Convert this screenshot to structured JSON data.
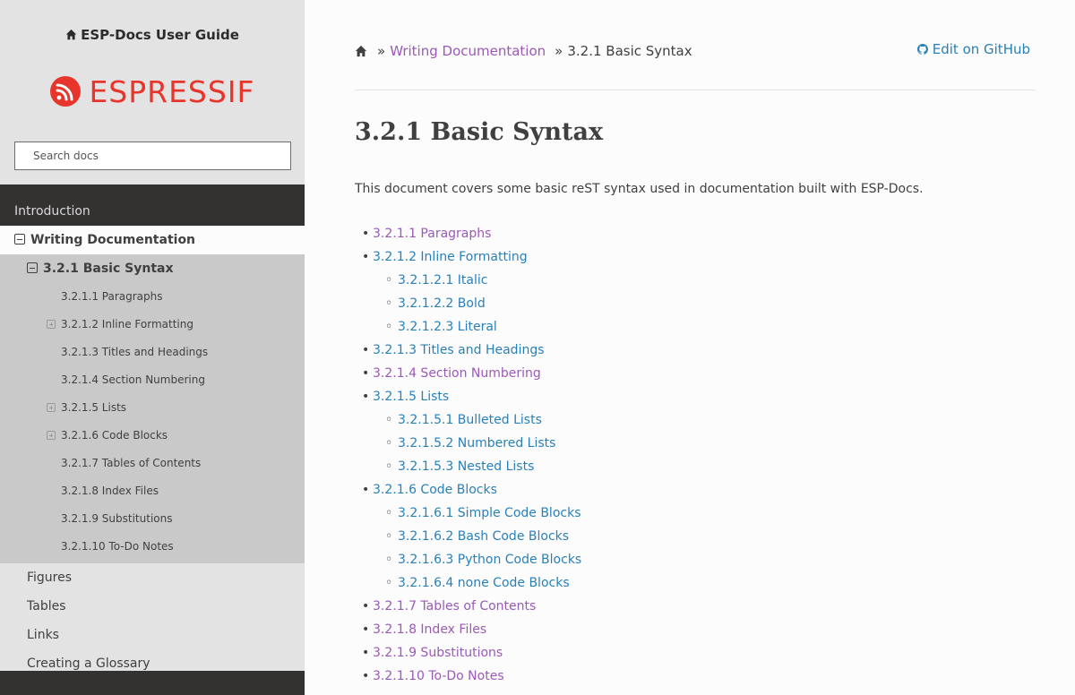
{
  "sidebar": {
    "project_title": "ESP-Docs User Guide",
    "logo_text": "ESPRESSIF",
    "search_placeholder": "Search docs",
    "intro": "Introduction",
    "writing_docs": "Writing Documentation",
    "basic_syntax": "3.2.1 Basic Syntax",
    "sub_items": [
      {
        "label": "3.2.1.1 Paragraphs",
        "expandable": false
      },
      {
        "label": "3.2.1.2 Inline Formatting",
        "expandable": true
      },
      {
        "label": "3.2.1.3 Titles and Headings",
        "expandable": false
      },
      {
        "label": "3.2.1.4 Section Numbering",
        "expandable": false
      },
      {
        "label": "3.2.1.5 Lists",
        "expandable": true
      },
      {
        "label": "3.2.1.6 Code Blocks",
        "expandable": true
      },
      {
        "label": "3.2.1.7 Tables of Contents",
        "expandable": false
      },
      {
        "label": "3.2.1.8 Index Files",
        "expandable": false
      },
      {
        "label": "3.2.1.9 Substitutions",
        "expandable": false
      },
      {
        "label": "3.2.1.10 To-Do Notes",
        "expandable": false
      }
    ],
    "other_items": [
      "Figures",
      "Tables",
      "Links",
      "Creating a Glossary"
    ]
  },
  "breadcrumb": {
    "sep": "»",
    "parent": "Writing Documentation",
    "current": "3.2.1 Basic Syntax",
    "edit_link": "Edit on GitHub"
  },
  "main": {
    "title": "3.2.1 Basic Syntax",
    "intro": "This document covers some basic reST syntax used in documentation built with ESP-Docs.",
    "toc": [
      {
        "label": "3.2.1.1 Paragraphs",
        "level": 1,
        "visited": true
      },
      {
        "label": "3.2.1.2 Inline Formatting",
        "level": 1,
        "visited": false
      },
      {
        "label": "3.2.1.2.1 Italic",
        "level": 2,
        "visited": false
      },
      {
        "label": "3.2.1.2.2 Bold",
        "level": 2,
        "visited": false
      },
      {
        "label": "3.2.1.2.3 Literal",
        "level": 2,
        "visited": false
      },
      {
        "label": "3.2.1.3 Titles and Headings",
        "level": 1,
        "visited": false
      },
      {
        "label": "3.2.1.4 Section Numbering",
        "level": 1,
        "visited": true
      },
      {
        "label": "3.2.1.5 Lists",
        "level": 1,
        "visited": false
      },
      {
        "label": "3.2.1.5.1 Bulleted Lists",
        "level": 2,
        "visited": false
      },
      {
        "label": "3.2.1.5.2 Numbered Lists",
        "level": 2,
        "visited": false
      },
      {
        "label": "3.2.1.5.3 Nested Lists",
        "level": 2,
        "visited": false
      },
      {
        "label": "3.2.1.6 Code Blocks",
        "level": 1,
        "visited": false
      },
      {
        "label": "3.2.1.6.1 Simple Code Blocks",
        "level": 2,
        "visited": false
      },
      {
        "label": "3.2.1.6.2 Bash Code Blocks",
        "level": 2,
        "visited": false
      },
      {
        "label": "3.2.1.6.3 Python Code Blocks",
        "level": 2,
        "visited": false
      },
      {
        "label": "3.2.1.6.4 none Code Blocks",
        "level": 2,
        "visited": false
      },
      {
        "label": "3.2.1.7 Tables of Contents",
        "level": 1,
        "visited": true
      },
      {
        "label": "3.2.1.8 Index Files",
        "level": 1,
        "visited": true
      },
      {
        "label": "3.2.1.9 Substitutions",
        "level": 1,
        "visited": true
      },
      {
        "label": "3.2.1.10 To-Do Notes",
        "level": 1,
        "visited": true
      }
    ]
  },
  "colors": {
    "visited_link": "#9b59b6",
    "link": "#2980b9",
    "brand": "#e7352c",
    "sidebar_dark": "#343131"
  },
  "icons": {
    "home": "home-icon",
    "github": "github-icon",
    "collapse": "minus-square-icon",
    "expand": "plus-square-icon"
  }
}
